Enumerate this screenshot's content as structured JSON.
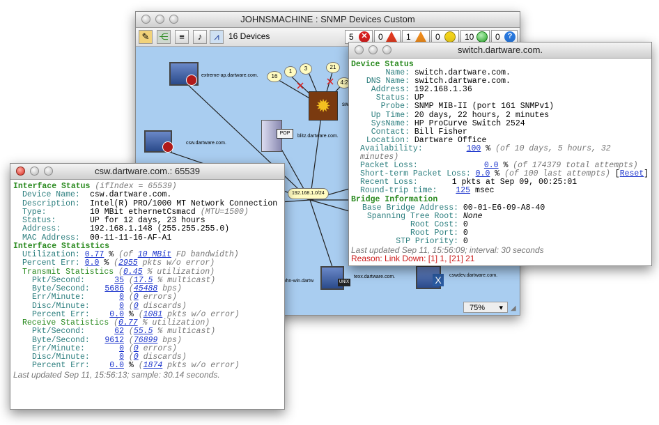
{
  "main_window": {
    "title": "JOHNSMACHINE : SNMP Devices Custom",
    "device_count": "16 Devices",
    "status_counts": [
      {
        "count": "5",
        "icon": "error-x-icon",
        "color": "#d82020"
      },
      {
        "count": "0",
        "icon": "warning-red-icon",
        "color": "#e23a20"
      },
      {
        "count": "1",
        "icon": "warning-orange-icon",
        "color": "#f08c1c"
      },
      {
        "count": "0",
        "icon": "warning-yellow-icon",
        "color": "#f4d41a"
      },
      {
        "count": "10",
        "icon": "ok-green-icon",
        "color": "#2ab02a"
      },
      {
        "count": "0",
        "icon": "unknown-blue-icon",
        "color": "#2a7ae0"
      }
    ],
    "zoom": "75%",
    "map": {
      "background": "#a9cdf0",
      "nodes": {
        "extreme": "extreme-ap.dartware.com.",
        "csw": "csw.dartware.com.",
        "blitz": "blitz.dartware.com.",
        "pop": "POP",
        "sw_partial": "sw",
        "network": "192.168.1.0/24",
        "john": "john-win.dartw",
        "unix": "UNIX",
        "texx": "texx.dartware.com.",
        "cswdev": "cswdev.dartware.com.",
        "x_badge": "X"
      },
      "port_bubbles": [
        "16",
        "1",
        "3",
        "21",
        "4:2"
      ]
    }
  },
  "switch_window": {
    "title": "switch.dartware.com.",
    "device_status_heading": "Device Status",
    "fields": [
      {
        "label": "Name:",
        "value": "switch.dartware.com."
      },
      {
        "label": "DNS Name:",
        "value": "switch.dartware.com."
      },
      {
        "label": "Address:",
        "value": "192.168.1.36"
      },
      {
        "label": "Status:",
        "value": "UP"
      },
      {
        "label": "Probe:",
        "value": "SNMP MIB-II (port 161 SNMPv1)"
      },
      {
        "label": "Up Time:",
        "value": "20 days, 22 hours, 2 minutes"
      },
      {
        "label": "SysName:",
        "value": "HP ProCurve Switch 2524"
      },
      {
        "label": "Contact:",
        "value": "Bill Fisher"
      },
      {
        "label": "Location:",
        "value": "Dartware Office"
      }
    ],
    "availability_label": "Availability:",
    "availability_value": "100",
    "availability_note": "(of 10 days, 5 hours, 32 minutes)",
    "packet_loss_label": "Packet Loss:",
    "packet_loss_value": "0.0",
    "packet_loss_note": "(of 174379 total attempts)",
    "st_loss_label": "Short-term Packet Loss:",
    "st_loss_value": "0.0",
    "st_loss_note": "(of 100 last attempts)",
    "reset_label": "Reset",
    "recent_loss_label": "Recent Loss:",
    "recent_loss_value": "1 pkts at Sep 09, 00:25:01",
    "rtt_label": "Round-trip time:",
    "rtt_value": "125",
    "rtt_unit": "msec",
    "bridge_heading": "Bridge Information",
    "bridge_fields": [
      {
        "label": "Base Bridge Address:",
        "value": "00-01-E6-09-A8-40"
      },
      {
        "label": "Spanning Tree Root:",
        "value": "None"
      },
      {
        "label": "Root Cost:",
        "value": "0"
      },
      {
        "label": "Root Port:",
        "value": "0"
      },
      {
        "label": "STP Priority:",
        "value": "0"
      }
    ],
    "last_updated": "Last updated Sep 11, 15:56:09; interval: 30 seconds",
    "reason_label": "Reason:",
    "reason_value": "Link Down: [1] 1, [21] 21"
  },
  "csw_window": {
    "title": "csw.dartware.com.: 65539",
    "interface_heading": "Interface Status",
    "ifindex_note": "(ifIndex = 65539)",
    "fields": [
      {
        "label": "Device Name:",
        "value": "csw.dartware.com."
      },
      {
        "label": "Description:",
        "value": "Intel(R) PRO/1000 MT Network Connection"
      },
      {
        "label": "Type:",
        "value": "10 MBit ethernetCsmacd",
        "note": "(MTU=1500)"
      },
      {
        "label": "Status:",
        "value": "UP for 12 days, 23 hours"
      },
      {
        "label": "Address:",
        "value": "192.168.1.148  (255.255.255.0)"
      },
      {
        "label": "MAC Address:",
        "value": "00-11-11-16-AF-A1"
      }
    ],
    "stats_heading": "Interface Statistics",
    "utilization_label": "Utilization:",
    "utilization_value": "0.77",
    "utilization_note_pre": "(of",
    "utilization_link": "10 MBit",
    "utilization_note_post": "FD bandwidth)",
    "percent_err_label": "Percent Err:",
    "percent_err_value": "0.0",
    "percent_err_note_num": "2955",
    "percent_err_note": "pkts w/o error)",
    "transmit_heading": "Transmit Statistics",
    "transmit_util": "0.45",
    "transmit_util_note": "% utilization)",
    "transmit": [
      {
        "label": "Pkt/Second:",
        "value": "35",
        "note_num": "17.5",
        "note": "% multicast)"
      },
      {
        "label": "Byte/Second:",
        "value": "5686",
        "note_num": "45488",
        "note": "bps)"
      },
      {
        "label": "Err/Minute:",
        "value": "0",
        "note_num": "0",
        "note": "errors)"
      },
      {
        "label": "Disc/Minute:",
        "value": "0",
        "note_num": "0",
        "note": "discards)"
      },
      {
        "label": "Percent Err:",
        "value": "0.0",
        "note_num": "1081",
        "note": "pkts w/o error)"
      }
    ],
    "receive_heading": "Receive Statistics",
    "receive_util": "0.77",
    "receive_util_note": "% utilization)",
    "receive": [
      {
        "label": "Pkt/Second:",
        "value": "62",
        "note_num": "55.5",
        "note": "% multicast)"
      },
      {
        "label": "Byte/Second:",
        "value": "9612",
        "note_num": "76899",
        "note": "bps)"
      },
      {
        "label": "Err/Minute:",
        "value": "0",
        "note_num": "0",
        "note": "errors)"
      },
      {
        "label": "Disc/Minute:",
        "value": "0",
        "note_num": "0",
        "note": "discards)"
      },
      {
        "label": "Percent Err:",
        "value": "0.0",
        "note_num": "1874",
        "note": "pkts w/o error)"
      }
    ],
    "last_updated": "Last updated Sep 11, 15:56:13; sample: 30.14 seconds."
  }
}
